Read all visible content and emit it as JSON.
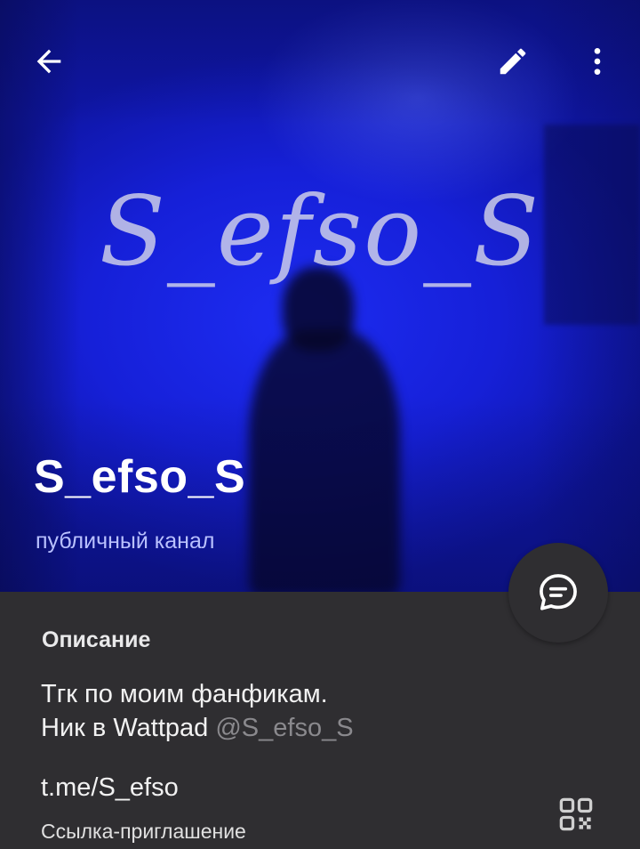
{
  "header": {
    "back_icon": "arrow-left-icon",
    "edit_icon": "pencil-icon",
    "more_icon": "more-vertical-icon"
  },
  "channel": {
    "cover_text": "S_efso_S",
    "title": "S_efso_S",
    "subtitle": "публичный канал",
    "accent_color": "#1a24e6"
  },
  "chat_button": {
    "icon": "chat-bubble-icon"
  },
  "description": {
    "heading": "Описание",
    "line1": "Тгк по моим фанфикам.",
    "line2_prefix": "Ник в Wattpad ",
    "line2_handle": "@S_efso_S"
  },
  "link": {
    "url": "t.me/S_efso",
    "caption": "Ссылка-приглашение",
    "qr_icon": "qr-code-icon"
  }
}
